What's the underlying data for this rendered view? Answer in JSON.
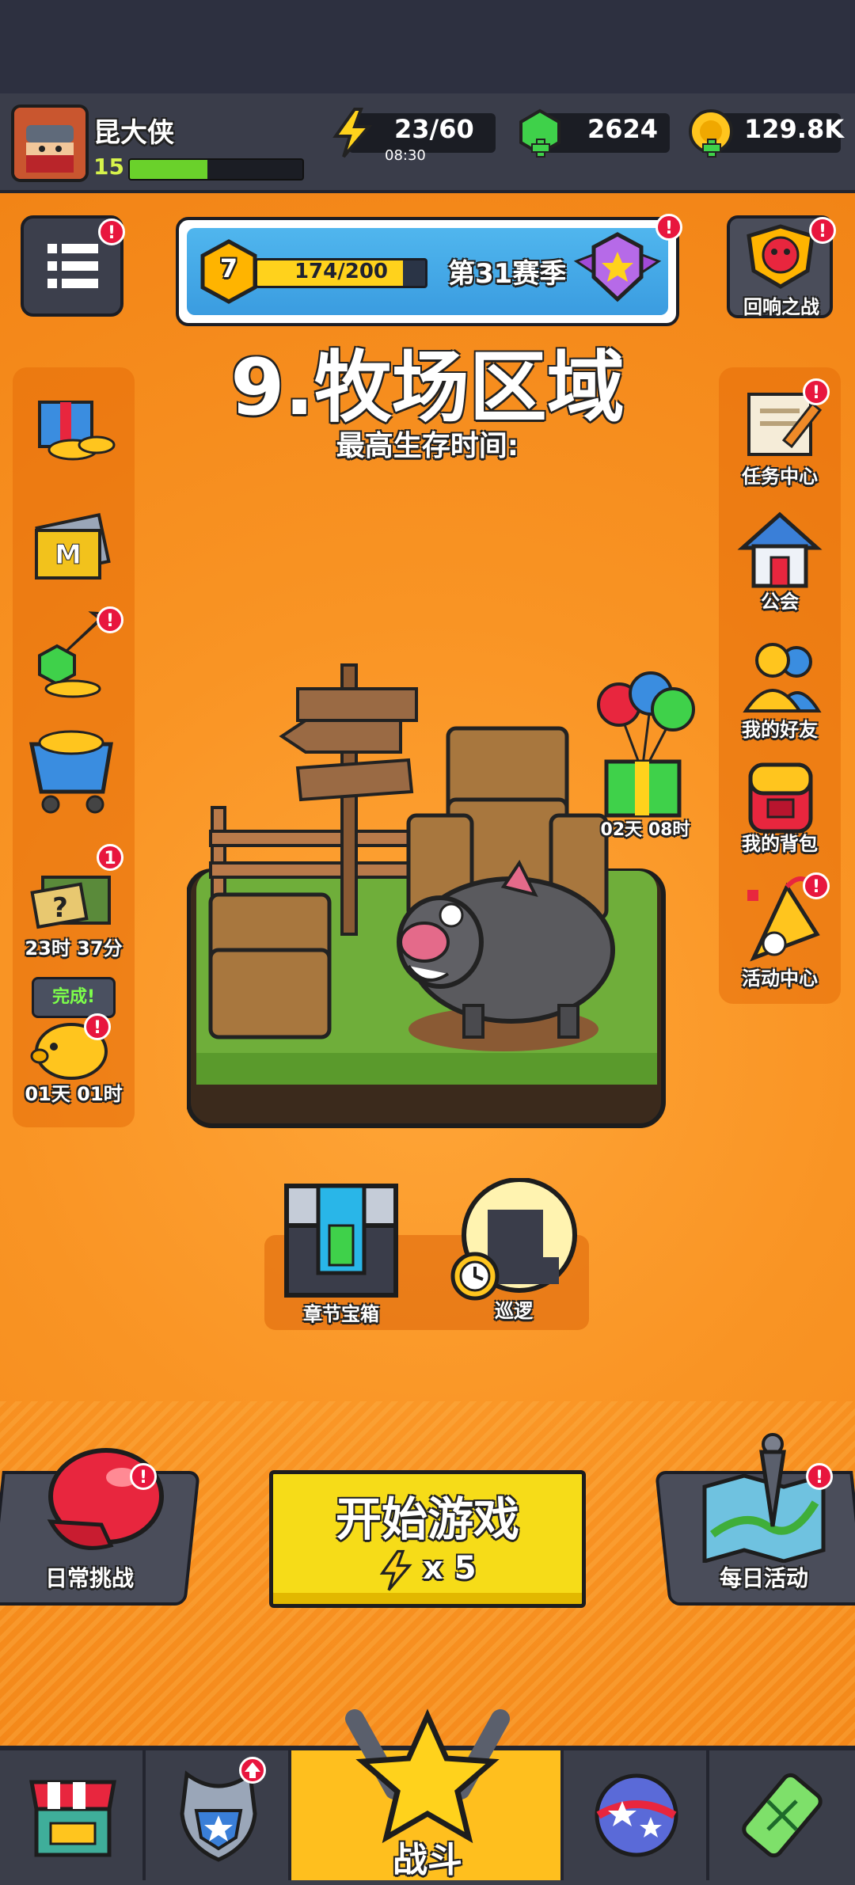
{
  "player": {
    "name": "昆大侠",
    "level": "15",
    "xp_fraction": 0.45
  },
  "resources": {
    "energy": "23/60",
    "energy_timer": "08:30",
    "gems": "2624",
    "coins": "129.8K"
  },
  "season": {
    "level": "7",
    "progress": "174/200",
    "progress_fraction": 0.87,
    "label": "第31赛季"
  },
  "event_top_right": {
    "label": "回响之战"
  },
  "stage": {
    "title": "9.牧场区域",
    "subtitle": "最高生存时间:"
  },
  "left_icons": [
    {
      "name": "gift-coins",
      "label": ""
    },
    {
      "name": "monthly-card",
      "label": ""
    },
    {
      "name": "upgrade-gems",
      "label": ""
    },
    {
      "name": "shop-cart",
      "label": ""
    },
    {
      "name": "mystery-crate",
      "label": "23时 37分",
      "badge": "1"
    },
    {
      "name": "piggy-bank",
      "label": "01天 01时",
      "tag": "完成!"
    }
  ],
  "right_icons": [
    {
      "label": "任务中心"
    },
    {
      "label": "公会"
    },
    {
      "label": "我的好友"
    },
    {
      "label": "我的背包"
    },
    {
      "label": "活动中心"
    }
  ],
  "balloon_gift": {
    "label": "02天 08时"
  },
  "chest": {
    "label": "章节宝箱"
  },
  "patrol": {
    "label": "巡逻"
  },
  "daily_challenge": {
    "label": "日常挑战"
  },
  "start_game": {
    "label": "开始游戏",
    "cost": "x 5"
  },
  "daily_activity": {
    "label": "每日活动"
  },
  "nav": {
    "battle_label": "战斗"
  },
  "colors": {
    "accent": "#f7901e",
    "button": "#f6dc18",
    "badge": "#e8163e"
  }
}
